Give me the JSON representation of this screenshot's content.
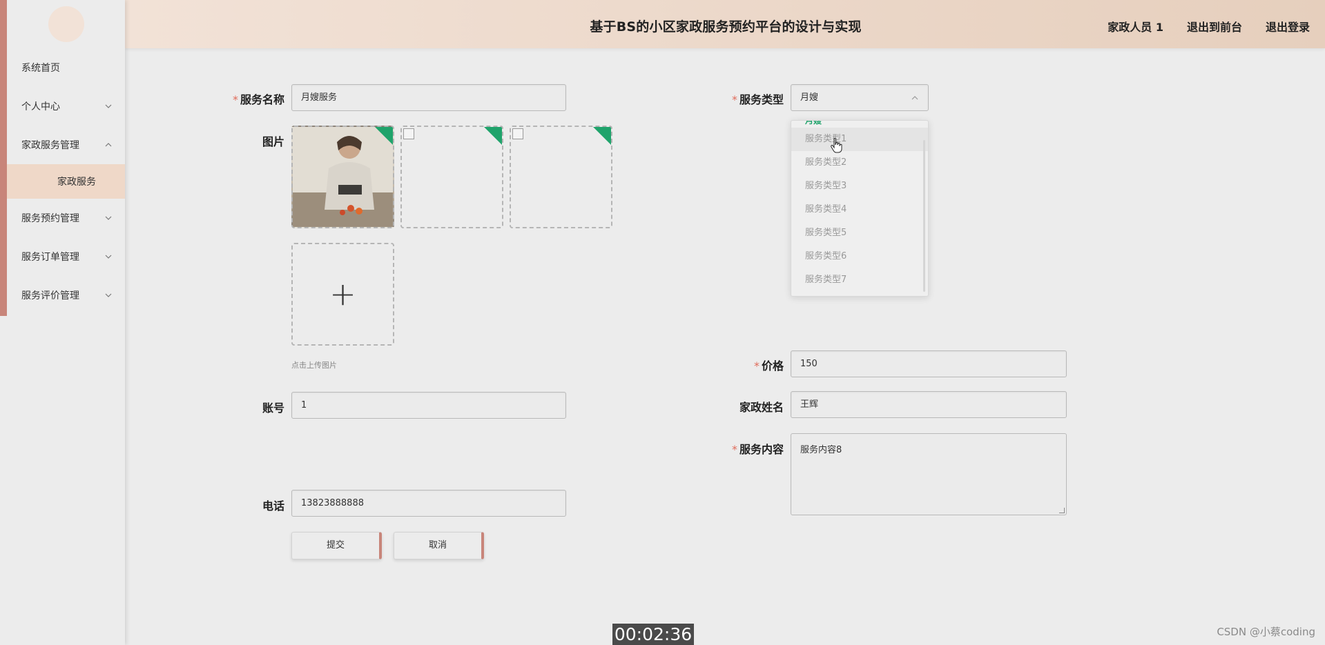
{
  "header": {
    "title": "基于BS的小区家政服务预约平台的设计与实现",
    "user": "家政人员 1",
    "frontend_link": "退出到前台",
    "logout_link": "退出登录"
  },
  "sidebar": {
    "items": [
      {
        "label": "系统首页"
      },
      {
        "label": "个人中心"
      },
      {
        "label": "家政服务管理"
      },
      {
        "label": "家政服务"
      },
      {
        "label": "服务预约管理"
      },
      {
        "label": "服务订单管理"
      },
      {
        "label": "服务评价管理"
      }
    ]
  },
  "form": {
    "service_name": {
      "label": "服务名称",
      "value": "月嫂服务"
    },
    "service_type": {
      "label": "服务类型",
      "value": "月嫂"
    },
    "images": {
      "label": "图片",
      "hint": "点击上传图片",
      "plus": "+"
    },
    "price": {
      "label": "价格",
      "value": "150"
    },
    "account": {
      "label": "账号",
      "value": "1"
    },
    "housekeeper_name": {
      "label": "家政姓名",
      "value": "王辉"
    },
    "service_content": {
      "label": "服务内容",
      "value": "服务内容8"
    },
    "phone": {
      "label": "电话",
      "value": "13823888888"
    },
    "submit": "提交",
    "cancel": "取消",
    "required_mark": "*"
  },
  "dropdown": {
    "partial_top": "月嫂",
    "options": [
      "服务类型1",
      "服务类型2",
      "服务类型3",
      "服务类型4",
      "服务类型5",
      "服务类型6",
      "服务类型7"
    ],
    "hovered_index": 0
  },
  "overlay": {
    "timestamp": "00:02:36",
    "watermark": "CSDN @小蔡coding"
  },
  "colors": {
    "accent": "#c8857a",
    "badge_green": "#1fa36b",
    "required": "#e06b5b"
  }
}
